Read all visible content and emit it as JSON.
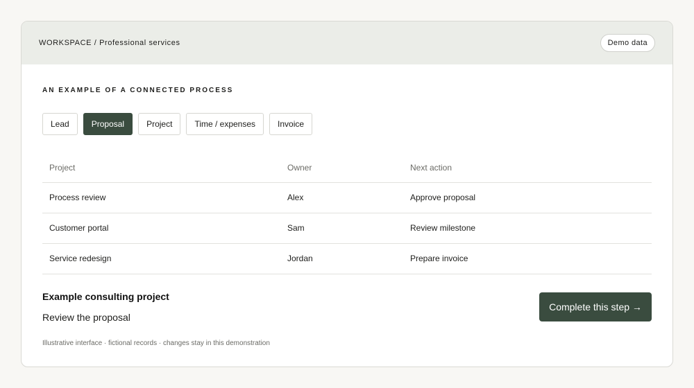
{
  "header": {
    "breadcrumb": "WORKSPACE / Professional services",
    "badge": "Demo data"
  },
  "section_title": "AN EXAMPLE OF A CONNECTED PROCESS",
  "steps": [
    {
      "label": "Lead",
      "active": false
    },
    {
      "label": "Proposal",
      "active": true
    },
    {
      "label": "Project",
      "active": false
    },
    {
      "label": "Time / expenses",
      "active": false
    },
    {
      "label": "Invoice",
      "active": false
    }
  ],
  "table": {
    "columns": [
      "Project",
      "Owner",
      "Next action"
    ],
    "rows": [
      [
        "Process review",
        "Alex",
        "Approve proposal"
      ],
      [
        "Customer portal",
        "Sam",
        "Review milestone"
      ],
      [
        "Service redesign",
        "Jordan",
        "Prepare invoice"
      ]
    ]
  },
  "detail": {
    "title": "Example consulting project",
    "subtitle": "Review the proposal"
  },
  "cta_label": "Complete this step →",
  "footnote": "Illustrative interface · fictional records · changes stay in this demonstration",
  "colors": {
    "accent": "#3a4c3f",
    "header_bg": "#ebede8",
    "page_bg": "#f8f7f4"
  }
}
